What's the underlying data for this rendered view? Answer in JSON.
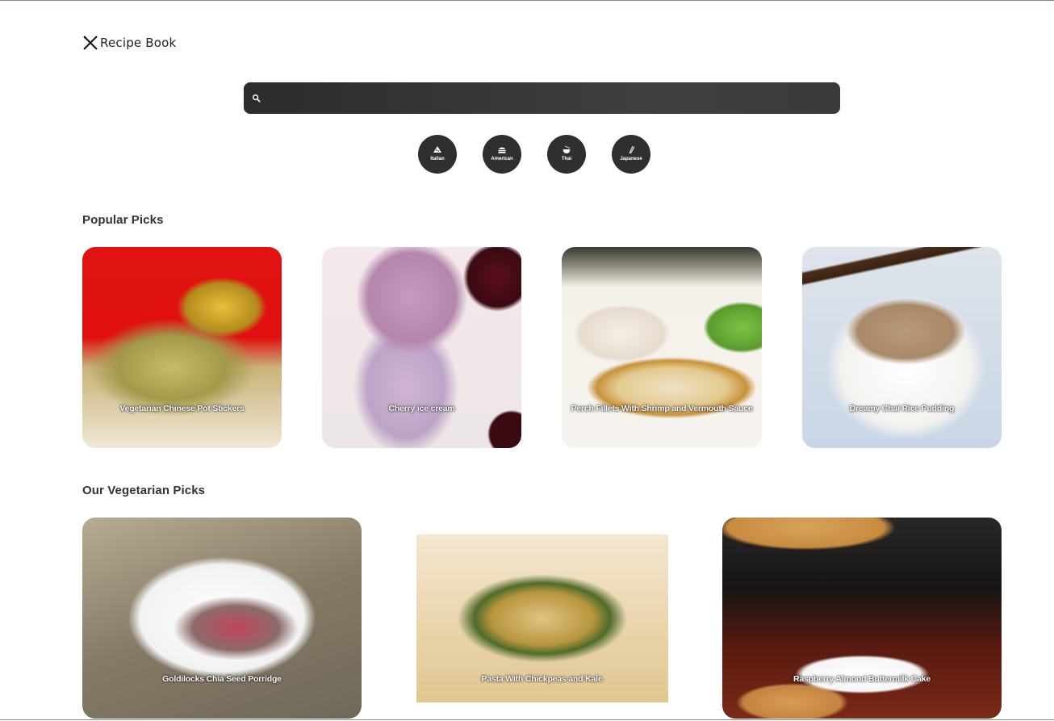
{
  "app": {
    "title": "Recipe Book"
  },
  "search": {
    "placeholder": "",
    "value": ""
  },
  "cuisines": [
    {
      "label": "Italian",
      "icon": "pizza-icon"
    },
    {
      "label": "American",
      "icon": "burger-icon"
    },
    {
      "label": "Thai",
      "icon": "bowl-icon"
    },
    {
      "label": "Japanese",
      "icon": "chopsticks-icon"
    }
  ],
  "sections": {
    "popular": {
      "title": "Popular Picks",
      "items": [
        {
          "title": "Vegetarian Chinese Pot Stickers"
        },
        {
          "title": "Cherry ice cream"
        },
        {
          "title": "Perch Fillets With Shrimp and Vermouth Sauce"
        },
        {
          "title": "Dreamy Chai Rice Pudding"
        }
      ]
    },
    "vegetarian": {
      "title": "Our Vegetarian Picks",
      "items": [
        {
          "title": "Goldilocks Chia Seed Porridge"
        },
        {
          "title": "Pasta With Chickpeas and Kale"
        },
        {
          "title": "Raspberry Almond Buttermilk Cake"
        }
      ]
    }
  },
  "colors": {
    "search_bg": "#3a3a3a",
    "cuisine_bg": "#2f2f2f",
    "text": "#333333"
  }
}
